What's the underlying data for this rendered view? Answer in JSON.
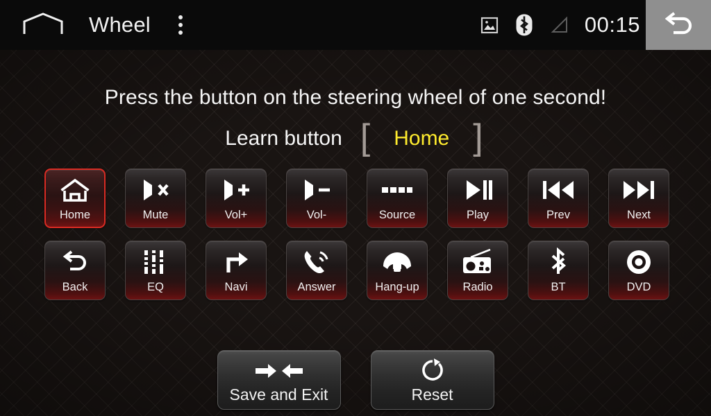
{
  "statusbar": {
    "home_icon": "home-outline-icon",
    "title": "Wheel",
    "overflow_icon": "overflow-menu-icon",
    "gallery_icon": "gallery-image-icon",
    "bluetooth_icon": "bluetooth-icon",
    "signal_icon": "signal-triangle-icon",
    "clock": "00:15",
    "back_icon": "back-arrow-icon"
  },
  "main": {
    "prompt": "Press the button on the steering wheel of one second!",
    "learn_label": "Learn button",
    "bracket_left": "[",
    "bracket_right": "]",
    "learn_value": "Home",
    "learn_value_color": "#ffec2e",
    "selected_key": "Home",
    "selected_border_color": "#d92b23"
  },
  "keys": [
    {
      "label": "Home",
      "icon": "home-icon",
      "selected": true
    },
    {
      "label": "Mute",
      "icon": "mute-icon",
      "selected": false
    },
    {
      "label": "Vol+",
      "icon": "volume-up-icon",
      "selected": false
    },
    {
      "label": "Vol-",
      "icon": "volume-down-icon",
      "selected": false
    },
    {
      "label": "Source",
      "icon": "source-icon",
      "selected": false
    },
    {
      "label": "Play",
      "icon": "play-pause-icon",
      "selected": false
    },
    {
      "label": "Prev",
      "icon": "previous-icon",
      "selected": false
    },
    {
      "label": "Next",
      "icon": "next-icon",
      "selected": false
    },
    {
      "label": "Back",
      "icon": "back-icon",
      "selected": false
    },
    {
      "label": "EQ",
      "icon": "equalizer-icon",
      "selected": false
    },
    {
      "label": "Navi",
      "icon": "navigation-icon",
      "selected": false
    },
    {
      "label": "Answer",
      "icon": "answer-call-icon",
      "selected": false
    },
    {
      "label": "Hang-up",
      "icon": "hangup-call-icon",
      "selected": false
    },
    {
      "label": "Radio",
      "icon": "radio-icon",
      "selected": false
    },
    {
      "label": "BT",
      "icon": "bluetooth-icon",
      "selected": false
    },
    {
      "label": "DVD",
      "icon": "dvd-disc-icon",
      "selected": false
    }
  ],
  "actions": [
    {
      "label": "Save and Exit",
      "icon": "save-exit-arrows-icon"
    },
    {
      "label": "Reset",
      "icon": "reset-refresh-icon"
    }
  ]
}
